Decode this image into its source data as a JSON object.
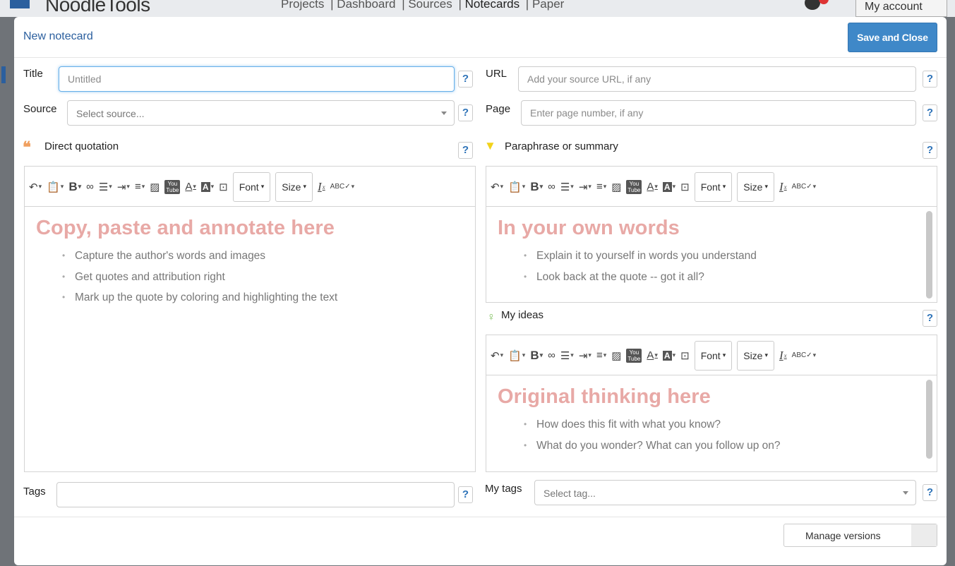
{
  "background": {
    "logo": "NoodleTools",
    "nav": [
      "Projects",
      "Dashboard",
      "Sources",
      "Notecards",
      "Paper"
    ],
    "account": "My account"
  },
  "modal": {
    "title": "New notecard",
    "save_label": "Save and Close"
  },
  "fields": {
    "title_label": "Title",
    "title_placeholder": "Untitled",
    "url_label": "URL",
    "url_placeholder": "Add your source URL, if any",
    "source_label": "Source",
    "source_placeholder": "Select source...",
    "page_label": "Page",
    "page_placeholder": "Enter page number, if any",
    "tags_label": "Tags",
    "my_tags_label": "My tags",
    "my_tags_placeholder": "Select tag...",
    "help": "?"
  },
  "sections": {
    "quotation": {
      "label": "Direct quotation",
      "heading": "Copy, paste and annotate here",
      "bullets": [
        "Capture the author's words and images",
        "Get quotes and attribution right",
        "Mark up the quote by coloring and highlighting the text"
      ]
    },
    "paraphrase": {
      "label": "Paraphrase or summary",
      "heading": "In your own words",
      "bullets": [
        "Explain it to yourself in words you understand",
        "Look back at the quote -- got it all?"
      ]
    },
    "ideas": {
      "label": "My ideas",
      "heading": "Original thinking here",
      "bullets": [
        "How does this fit with what you know?",
        "What do you wonder? What can you follow up on?"
      ]
    }
  },
  "toolbar": {
    "font_label": "Font",
    "size_label": "Size"
  },
  "footer": {
    "versions_label": "Manage versions"
  },
  "colors": {
    "accent": "#3f88c8",
    "title_blue": "#2b5f9e",
    "placeholder_heading": "#e8a9a6",
    "quote_icon": "#f0a060",
    "funnel_icon": "#f2d21a",
    "bulb_icon": "#7cbf5a"
  }
}
